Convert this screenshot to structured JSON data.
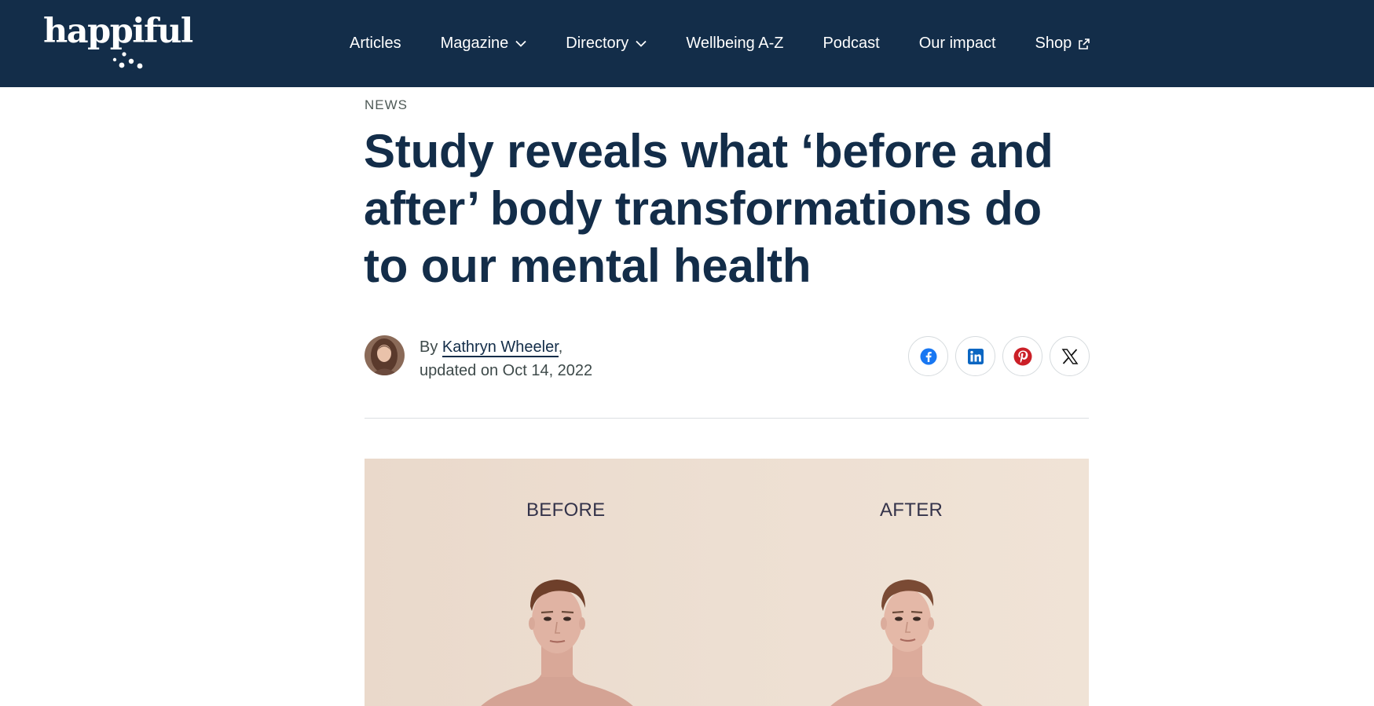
{
  "header": {
    "logo_text": "happiful",
    "nav": [
      {
        "label": "Articles",
        "icon": null
      },
      {
        "label": "Magazine",
        "icon": "chevron-down-icon"
      },
      {
        "label": "Directory",
        "icon": "chevron-down-icon"
      },
      {
        "label": "Wellbeing A-Z",
        "icon": null
      },
      {
        "label": "Podcast",
        "icon": null
      },
      {
        "label": "Our impact",
        "icon": null
      },
      {
        "label": "Shop",
        "icon": "external-link-icon"
      }
    ]
  },
  "article": {
    "category": "NEWS",
    "title": "Study reveals what ‘before and after’ body transformations do to our mental health",
    "byline_prefix": "By",
    "author": "Kathryn Wheeler",
    "byline_suffix": ",",
    "updated": "updated on Oct 14, 2022"
  },
  "share": [
    {
      "network": "Facebook",
      "icon": "facebook-icon",
      "color": "#1877f2"
    },
    {
      "network": "LinkedIn",
      "icon": "linkedin-icon",
      "color": "#0a66c2"
    },
    {
      "network": "Pinterest",
      "icon": "pinterest-icon",
      "color": "#cb1f27"
    },
    {
      "network": "X",
      "icon": "x-icon",
      "color": "#000000"
    }
  ],
  "hero": {
    "label_before": "BEFORE",
    "label_after": "AFTER"
  },
  "colors": {
    "header_bg": "#132d49",
    "headline": "#132d49",
    "hero_bg": "#ecdccf"
  }
}
